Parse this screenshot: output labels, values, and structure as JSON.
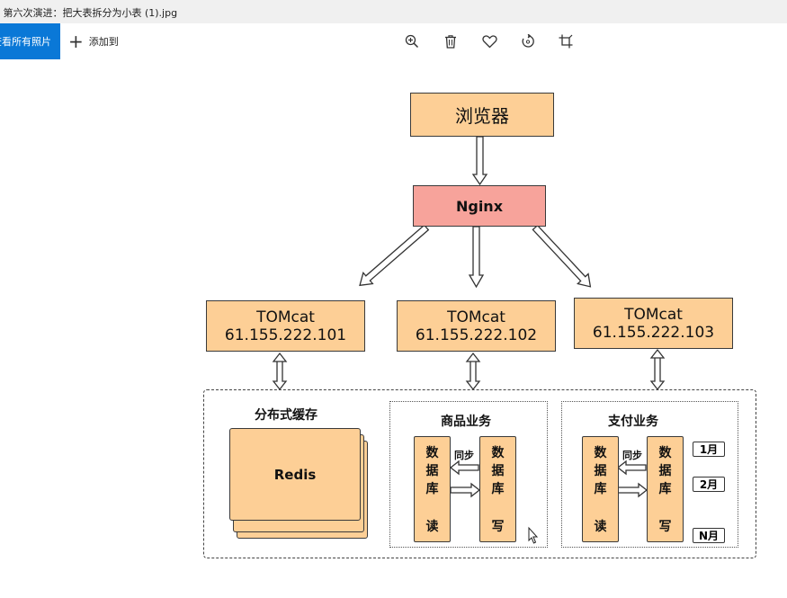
{
  "window": {
    "title": "- 第六次演进：把大表拆分为小表 (1).jpg"
  },
  "toolbar": {
    "view_all_label": "查看所有照片",
    "add_to_label": "添加到",
    "icons": [
      "zoom-in-icon",
      "delete-icon",
      "favorite-icon",
      "rotate-icon",
      "crop-icon"
    ]
  },
  "diagram": {
    "browser": "浏览器",
    "nginx": "Nginx",
    "tomcats": [
      {
        "name": "TOMcat",
        "ip": "61.155.222.101"
      },
      {
        "name": "TOMcat",
        "ip": "61.155.222.102"
      },
      {
        "name": "TOMcat",
        "ip": "61.155.222.103"
      }
    ],
    "cache": {
      "title": "分布式缓存",
      "redis": "Redis"
    },
    "product": {
      "title": "商品业务",
      "read_db": [
        "数",
        "据",
        "库",
        "读"
      ],
      "write_db": [
        "数",
        "据",
        "库",
        "写"
      ],
      "sync": "同步"
    },
    "payment": {
      "title": "支付业务",
      "read_db": [
        "数",
        "据",
        "库",
        "读"
      ],
      "write_db": [
        "数",
        "据",
        "库",
        "写"
      ],
      "sync": "同步",
      "months": [
        "1月",
        "2月",
        "N月"
      ]
    },
    "colors": {
      "box": "#fdcf96",
      "nginx": "#f7a39b",
      "accent": "#0a78d7"
    }
  }
}
